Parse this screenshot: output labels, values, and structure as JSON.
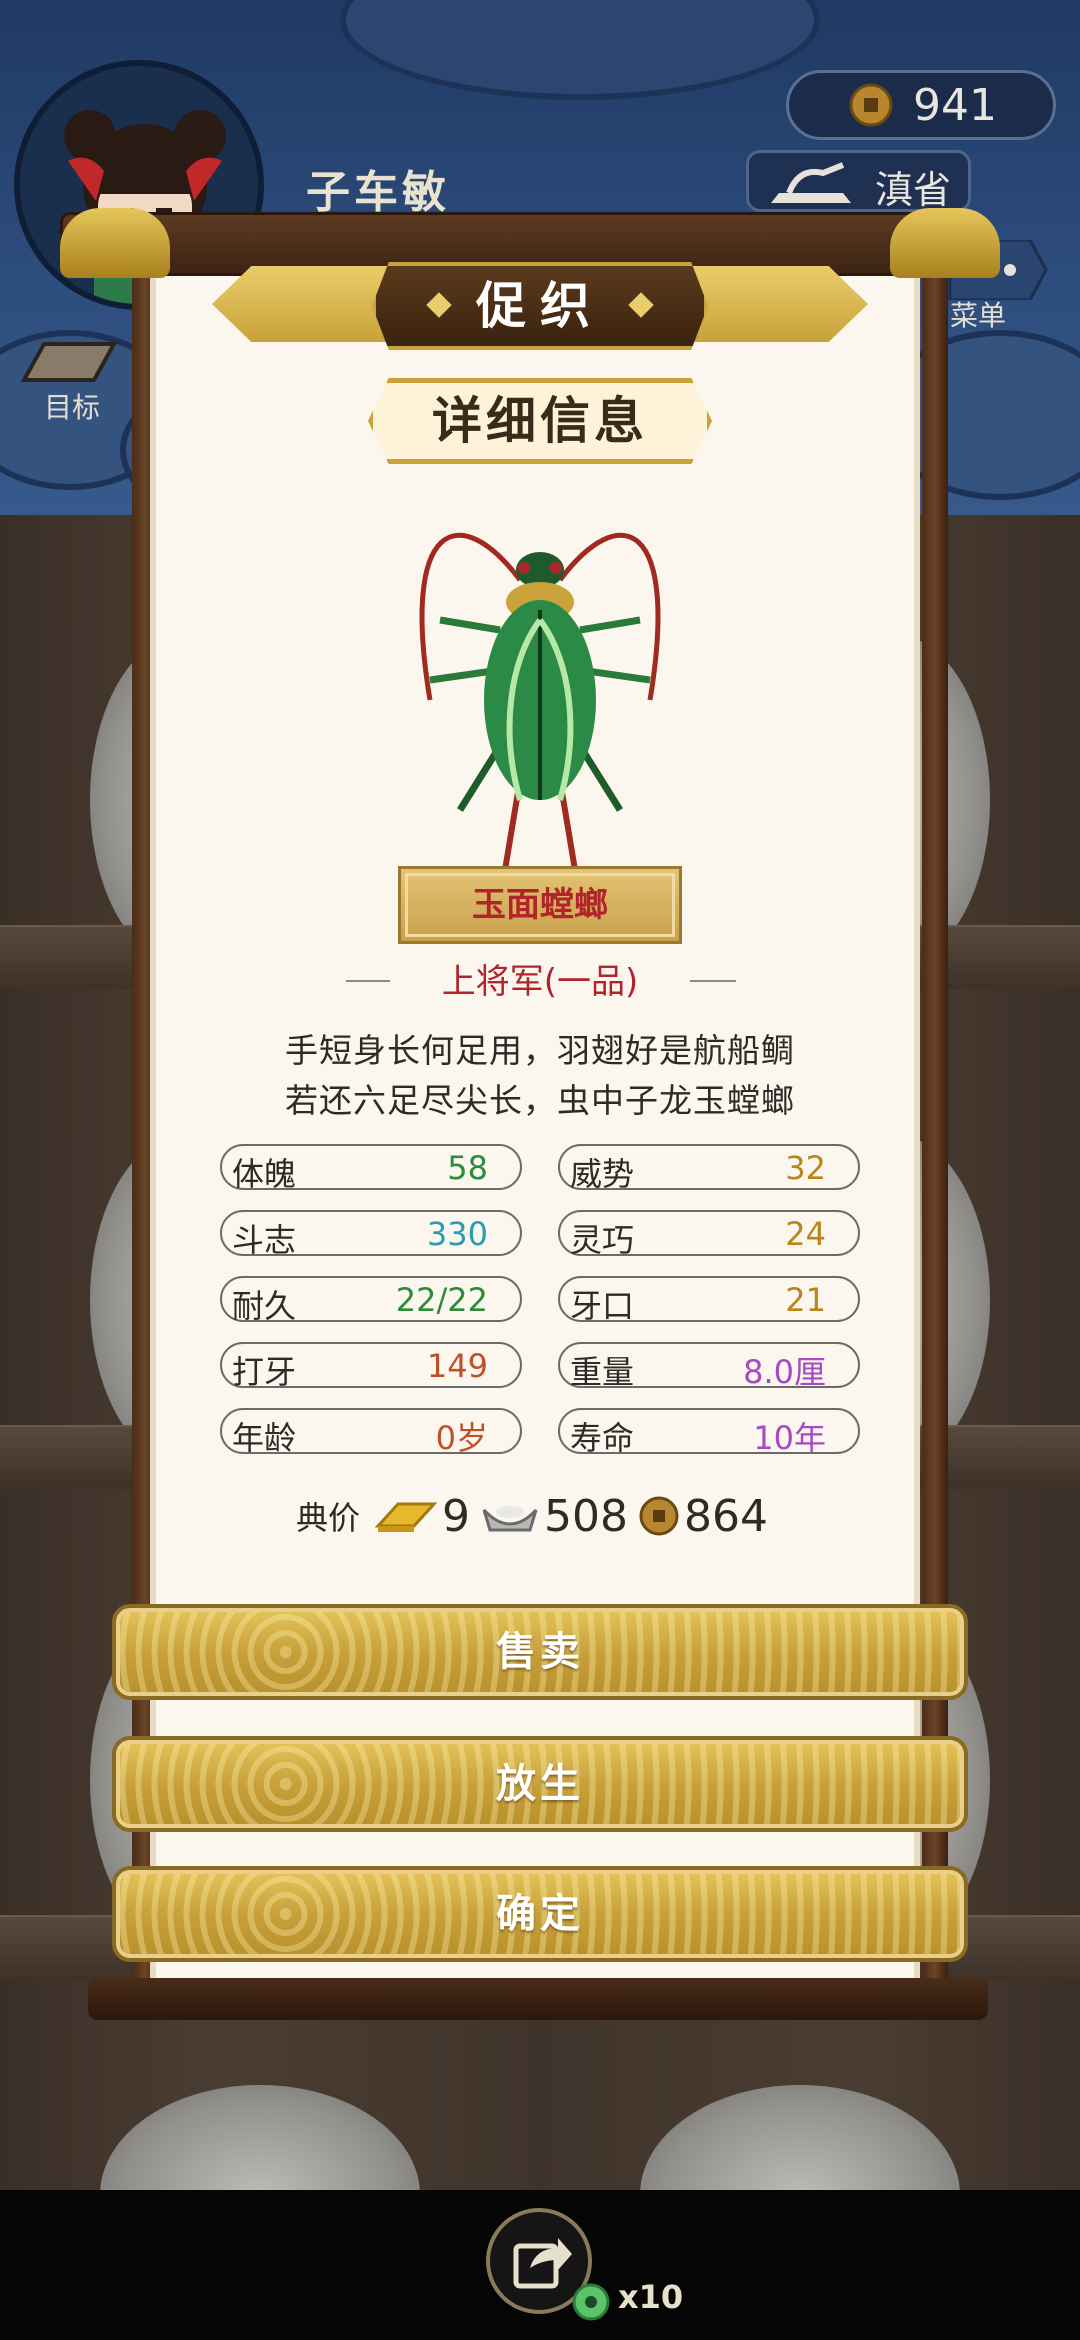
{
  "player": {
    "name": "子车敏"
  },
  "currency": {
    "coins": "941",
    "coin_icon": "copper-coin-icon"
  },
  "region": {
    "label": "滇省"
  },
  "side_buttons": {
    "goal": "目标",
    "menu": "菜单"
  },
  "panel": {
    "header": "促织",
    "title": "详细信息",
    "insect_name": "玉面螳螂",
    "rank": "上将军(一品)",
    "poem_line_1": "手短身长何足用，羽翅好是航船鲷",
    "poem_line_2": "若还六足尽尖长，虫中子龙玉螳螂",
    "stats": [
      {
        "label": "体魄",
        "value": "58",
        "color": "#2e8b3a"
      },
      {
        "label": "威势",
        "value": "32",
        "color": "#b8861a"
      },
      {
        "label": "斗志",
        "value": "330",
        "color": "#2a9bb0"
      },
      {
        "label": "灵巧",
        "value": "24",
        "color": "#b8861a"
      },
      {
        "label": "耐久",
        "value": "22/22",
        "color": "#2e8b3a"
      },
      {
        "label": "牙口",
        "value": "21",
        "color": "#b8861a"
      },
      {
        "label": "打牙",
        "value": "149",
        "color": "#c0502a"
      },
      {
        "label": "重量",
        "value": "8.0厘",
        "color": "#a64bc4"
      },
      {
        "label": "年龄",
        "value": "0岁",
        "color": "#c0502a"
      },
      {
        "label": "寿命",
        "value": "10年",
        "color": "#a64bc4"
      }
    ],
    "price": {
      "label": "典价",
      "gold": "9",
      "silver": "508",
      "copper": "864"
    }
  },
  "actions": {
    "sell": "售卖",
    "release": "放生",
    "confirm": "确定"
  },
  "bottom": {
    "share_count": "x10"
  }
}
